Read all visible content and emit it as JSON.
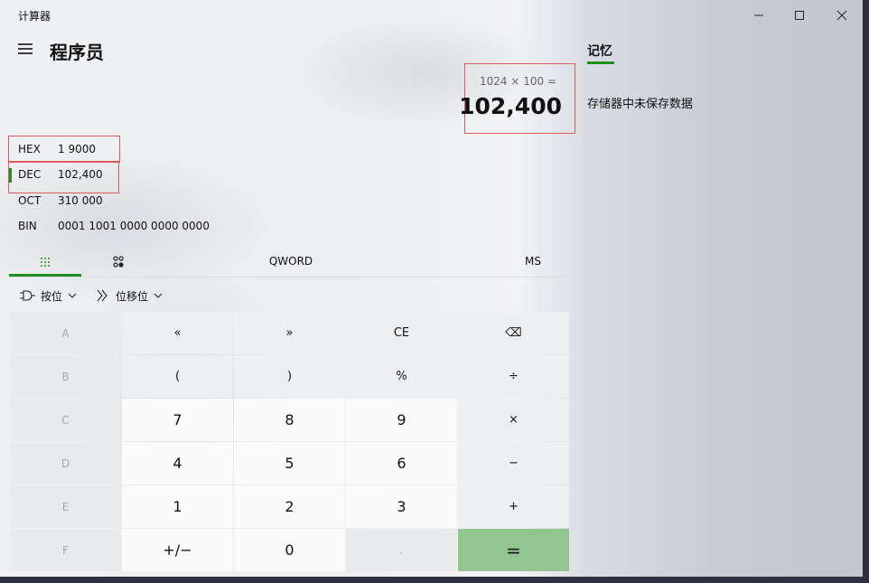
{
  "window": {
    "title": "计算器"
  },
  "header": {
    "mode": "程序员"
  },
  "display": {
    "expression": "1024 × 100 =",
    "result": "102,400"
  },
  "radix": [
    {
      "label": "HEX",
      "value": "1 9000"
    },
    {
      "label": "DEC",
      "value": "102,400"
    },
    {
      "label": "OCT",
      "value": "310 000"
    },
    {
      "label": "BIN",
      "value": "0001 1001 0000 0000 0000"
    }
  ],
  "toolbar": {
    "word_size": "QWORD",
    "ms": "MS",
    "bitwise": "按位",
    "bitshift": "位移位"
  },
  "keys": [
    [
      "A",
      "«",
      "»",
      "CE",
      "⌫"
    ],
    [
      "B",
      "(",
      ")",
      "%",
      "÷"
    ],
    [
      "C",
      "7",
      "8",
      "9",
      "×"
    ],
    [
      "D",
      "4",
      "5",
      "6",
      "−"
    ],
    [
      "E",
      "1",
      "2",
      "3",
      "+"
    ],
    [
      "F",
      "+/−",
      "0",
      ".",
      "="
    ]
  ],
  "memory": {
    "tab": "记忆",
    "empty": "存储器中未保存数据"
  },
  "colors": {
    "accent": "#1f8f1f",
    "equals": "#93c591",
    "highlight": "#e05a5a"
  }
}
